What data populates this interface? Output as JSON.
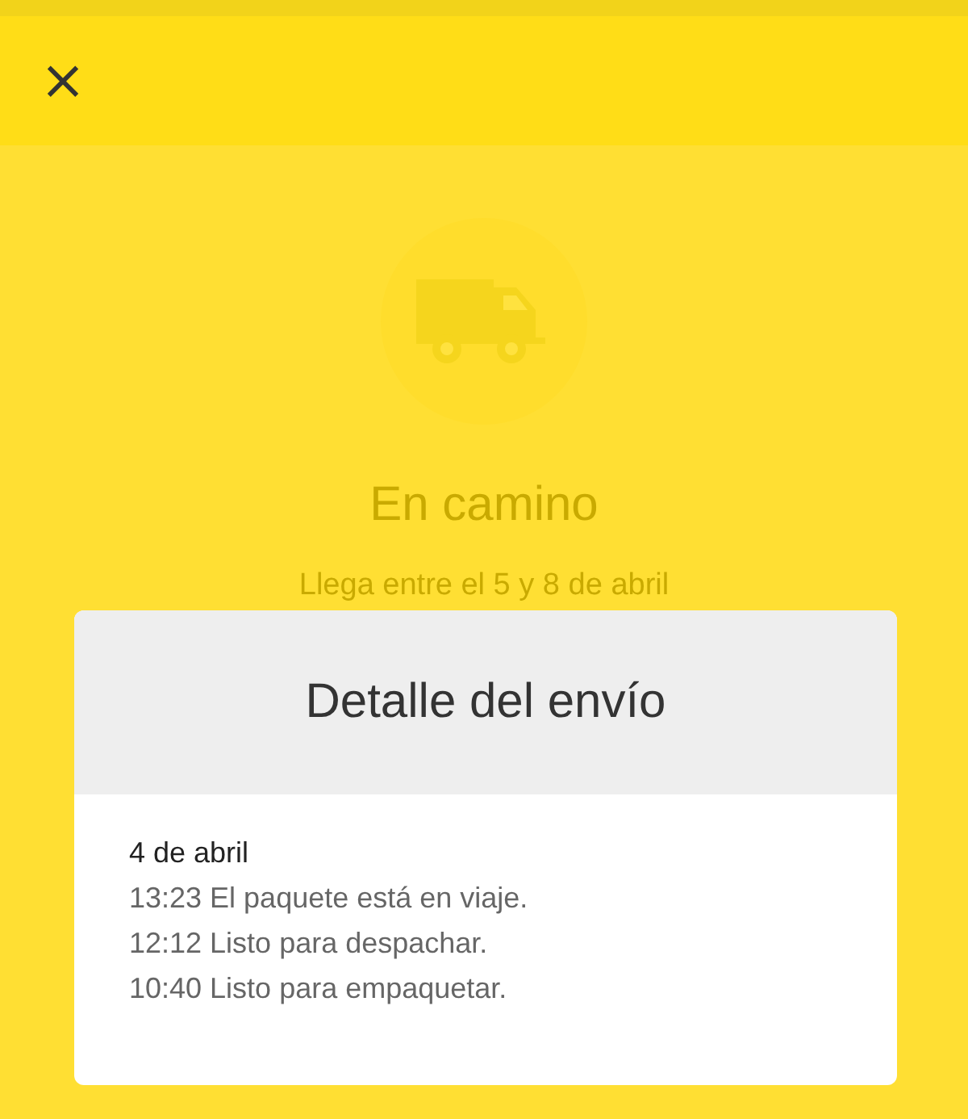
{
  "header": {
    "close_icon": "×"
  },
  "status": {
    "title": "En camino",
    "subtitle": "Llega entre el 5 y 8 de abril"
  },
  "dialog": {
    "title": "Detalle del envío",
    "date": "4 de abril",
    "events": [
      {
        "time": "13:23",
        "text": "El paquete está en viaje."
      },
      {
        "time": "12:12",
        "text": "Listo para despachar."
      },
      {
        "time": "10:40",
        "text": "Listo para empaquetar."
      }
    ]
  }
}
